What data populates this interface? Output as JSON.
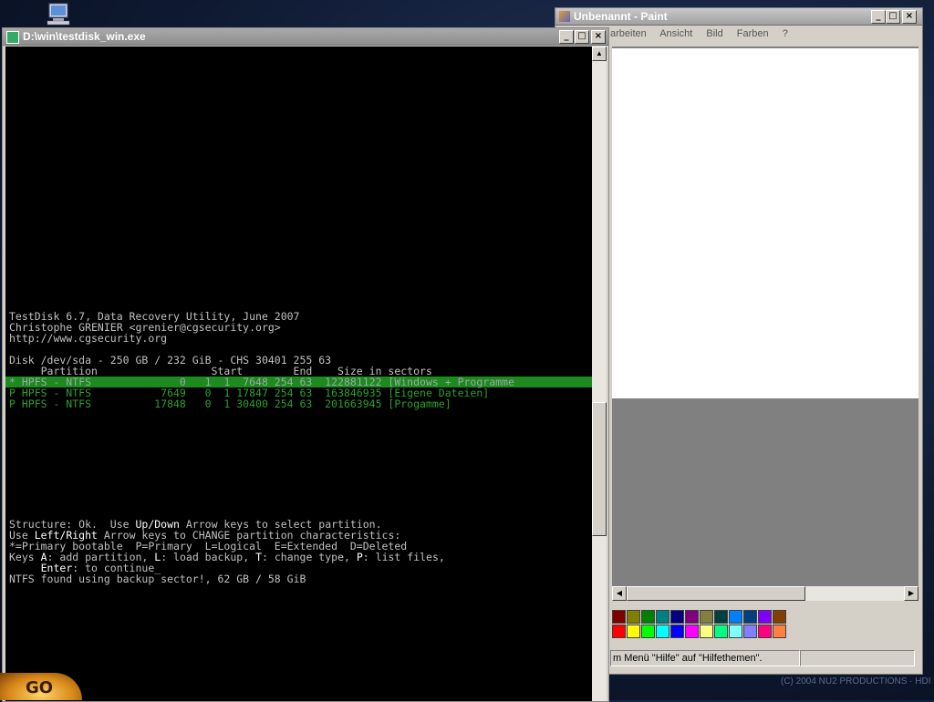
{
  "console": {
    "title": "D:\\win\\testdisk_win.exe",
    "lines": {
      "l1": "TestDisk 6.7, Data Recovery Utility, June 2007",
      "l2": "Christophe GRENIER <grenier@cgsecurity.org>",
      "l3": "http://www.cgsecurity.org",
      "disk": "Disk /dev/sda - 250 GB / 232 GiB - CHS 30401 255 63",
      "header": "     Partition                  Start        End    Size in sectors",
      "row1": "* HPFS - NTFS              0   1  1  7648 254 63  122881122 [Windows + Programme",
      "row2": "P HPFS - NTFS           7649   0  1 17847 254 63  163846935 [Eigene Dateien]",
      "row3": "P HPFS - NTFS          17848   0  1 30400 254 63  201663945 [Progamme]",
      "s1a": "Structure: Ok.  Use ",
      "s1b": "Up/Down",
      "s1c": " Arrow keys to select partition.",
      "s2a": "Use ",
      "s2b": "Left/Right",
      "s2c": " Arrow keys to CHANGE partition characteristics:",
      "s3": "*=Primary bootable  P=Primary  L=Logical  E=Extended  D=Deleted",
      "s4a": "Keys ",
      "s4b": "A",
      "s4c": ": add partition, ",
      "s4d": "L",
      "s4e": ": load backup, ",
      "s4f": "T",
      "s4g": ": change type, ",
      "s4h": "P",
      "s4i": ": list files,",
      "s5a": "     ",
      "s5b": "Enter",
      "s5c": ": to continue_",
      "s6": "NTFS found using backup sector!, 62 GB / 58 GiB"
    }
  },
  "paint": {
    "title": "Unbenannt - Paint",
    "menu": [
      "arbeiten",
      "Ansicht",
      "Bild",
      "Farben",
      "?"
    ],
    "status_text": "m Menü \"Hilfe\" auf \"Hilfethemen\".",
    "palette_top": [
      "#800000",
      "#808000",
      "#008000",
      "#008080",
      "#000080",
      "#800080",
      "#808040",
      "#004040",
      "#0080ff",
      "#004080",
      "#8000ff",
      "#804000"
    ],
    "palette_bottom": [
      "#ff0000",
      "#ffff00",
      "#00ff00",
      "#00ffff",
      "#0000ff",
      "#ff00ff",
      "#ffff80",
      "#00ff80",
      "#80ffff",
      "#8080ff",
      "#ff0080",
      "#ff8040"
    ]
  },
  "taskbar": {
    "go_label": "GO"
  },
  "desktop": {
    "copyright": "(C) 2004 NU2 PRODUCTIONS · HDI"
  },
  "window_buttons": {
    "minimize": "_",
    "maximize": "□",
    "close": "×"
  }
}
